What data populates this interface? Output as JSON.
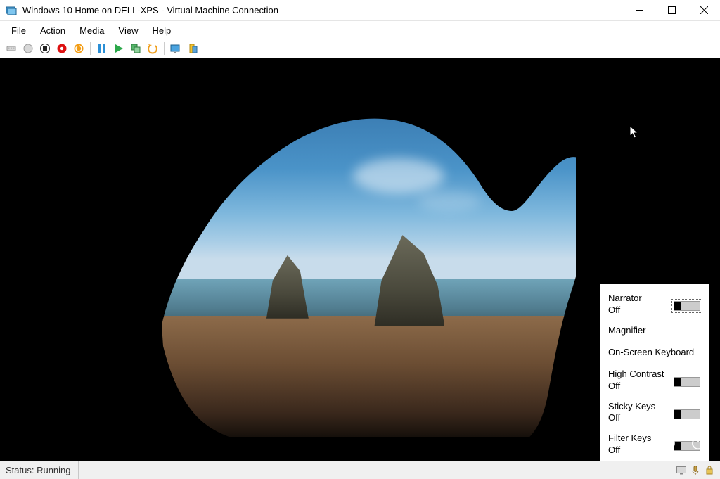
{
  "titlebar": {
    "title": "Windows 10 Home on DELL-XPS - Virtual Machine Connection"
  },
  "menubar": {
    "items": [
      "File",
      "Action",
      "Media",
      "View",
      "Help"
    ]
  },
  "toolbar": {
    "icons": [
      "ctrl-alt-del-icon",
      "power-icon",
      "stop-icon",
      "shutdown-icon",
      "reset-icon",
      "pause-icon",
      "start-icon",
      "checkpoint-icon",
      "revert-icon",
      "enhanced-session-icon",
      "share-icon"
    ]
  },
  "ease": {
    "items": [
      {
        "label": "Narrator",
        "state": "Off",
        "toggle": true,
        "focused": true
      },
      {
        "label": "Magnifier",
        "toggle": false
      },
      {
        "label": "On-Screen Keyboard",
        "toggle": false
      },
      {
        "label": "High Contrast",
        "state": "Off",
        "toggle": true
      },
      {
        "label": "Sticky Keys",
        "state": "Off",
        "toggle": true
      },
      {
        "label": "Filter Keys",
        "state": "Off",
        "toggle": true
      }
    ]
  },
  "statusbar": {
    "text": "Status: Running"
  }
}
